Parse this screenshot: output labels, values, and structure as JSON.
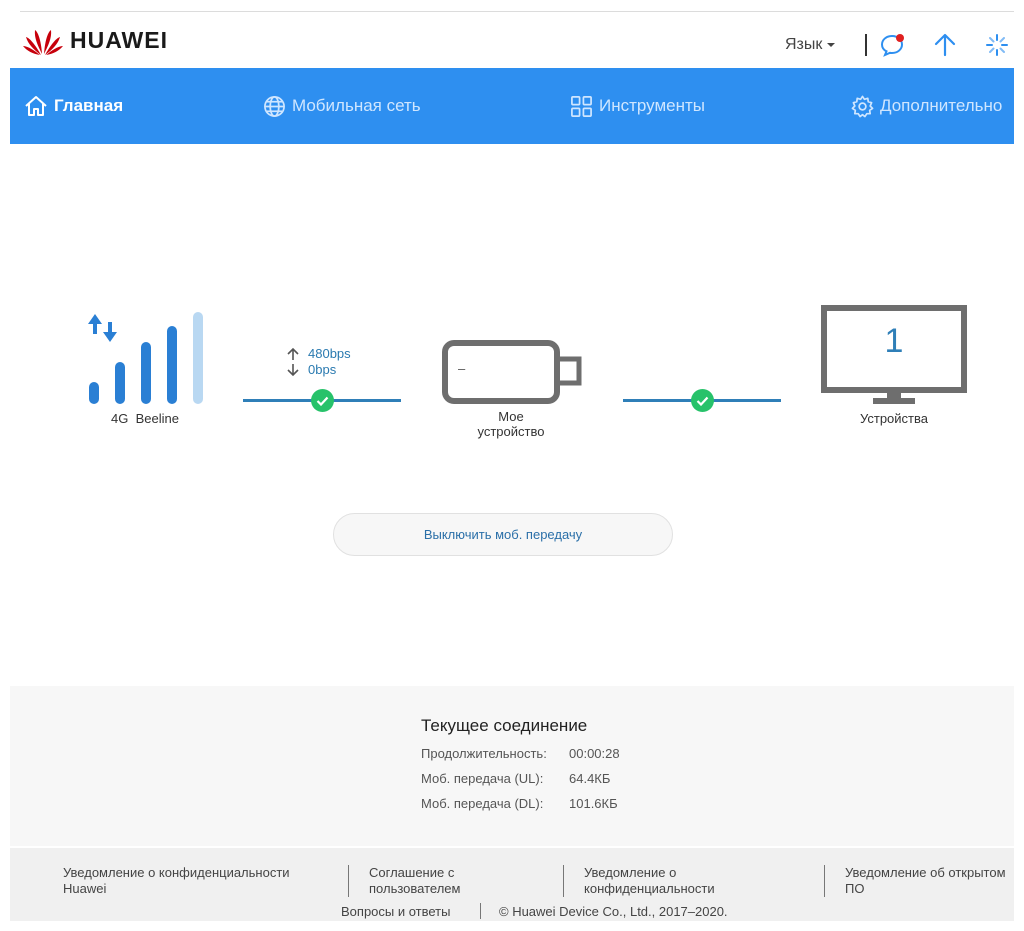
{
  "header": {
    "brand": "HUAWEI",
    "language_label": "Язык",
    "icons": [
      "messages-icon",
      "update-icon",
      "loading-icon"
    ]
  },
  "nav": {
    "items": [
      {
        "label": "Главная",
        "icon": "home-icon",
        "active": true
      },
      {
        "label": "Мобильная сеть",
        "icon": "globe-icon",
        "active": false
      },
      {
        "label": "Инструменты",
        "icon": "grid-icon",
        "active": false
      },
      {
        "label": "Дополнительно",
        "icon": "gear-icon",
        "active": false
      }
    ]
  },
  "status": {
    "network_type": "4G",
    "operator": "Beeline",
    "upload_rate": "480bps",
    "download_rate": "0bps",
    "device_label_line1": "Мое",
    "device_label_line2": "устройство",
    "device_label_short": "–",
    "connected_devices_count": "1",
    "connected_devices_label": "Устройства",
    "signal_bars": 4,
    "signal_bars_max": 5
  },
  "actions": {
    "toggle_mobile_data": "Выключить моб. передачу"
  },
  "connection": {
    "title": "Текущее соединение",
    "rows": [
      {
        "label": "Продолжительность:",
        "value": "00:00:28"
      },
      {
        "label": "Моб. передача (UL):",
        "value": "64.4КБ"
      },
      {
        "label": "Моб. передача (DL):",
        "value": "101.6КБ"
      }
    ]
  },
  "footer": {
    "links": [
      {
        "line1": "Уведомление о конфиденциальности",
        "line2": "Huawei"
      },
      {
        "line1": "Соглашение с",
        "line2": "пользователем"
      },
      {
        "line1": "Уведомление о",
        "line2": "конфиденциальности"
      },
      {
        "line1": "Уведомление об открытом",
        "line2": "ПО"
      }
    ],
    "faq": "Вопросы и ответы",
    "copyright": "© Huawei Device Co., Ltd., 2017–2020."
  },
  "colors": {
    "nav_bg": "#2e8ff0",
    "accent_blue": "#2f7fb8",
    "ok_green": "#27c26a",
    "brand_red": "#c7000b",
    "device_gray": "#6e6e6e"
  }
}
